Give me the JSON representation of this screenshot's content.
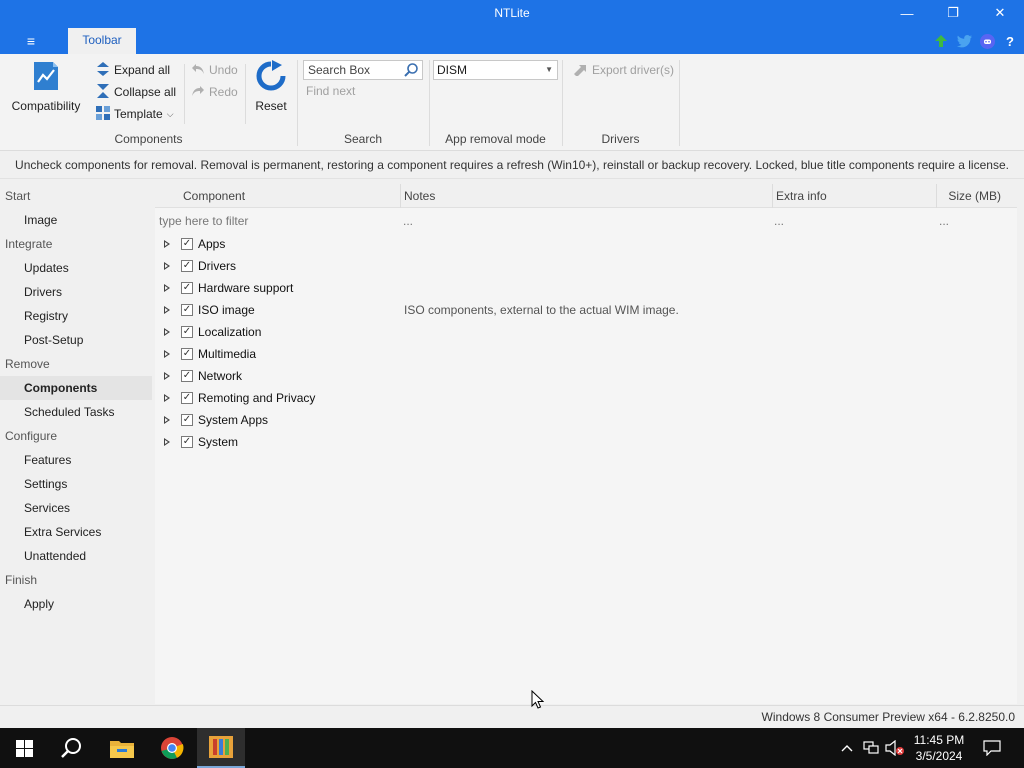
{
  "window": {
    "title": "NTLite",
    "minimize_glyph": "—",
    "maximize_glyph": "❐",
    "close_glyph": "✕"
  },
  "menu": {
    "hamburger_glyph": "≡",
    "tab_label": "Toolbar"
  },
  "top_icons": [
    "upgrade-arrow-icon",
    "twitter-icon",
    "discord-icon",
    "help-icon"
  ],
  "ribbon": {
    "compatibility_label": "Compatibility",
    "expand_all_label": "Expand all",
    "collapse_all_label": "Collapse all",
    "template_label": "Template",
    "undo_label": "Undo",
    "redo_label": "Redo",
    "reset_label": "Reset",
    "components_group": "Components",
    "search_placeholder": "Search Box",
    "find_next_label": "Find next",
    "search_group": "Search",
    "app_removal_value": "DISM",
    "app_removal_group": "App removal mode",
    "export_drivers_label": "Export driver(s)",
    "drivers_group": "Drivers"
  },
  "info_message": "Uncheck components for removal. Removal is permanent, restoring a component requires a refresh (Win10+), reinstall or backup recovery. Locked, blue title components require a license.",
  "sidebar": [
    {
      "type": "header",
      "label": "Start"
    },
    {
      "type": "item",
      "label": "Image"
    },
    {
      "type": "header",
      "label": "Integrate"
    },
    {
      "type": "item",
      "label": "Updates"
    },
    {
      "type": "item",
      "label": "Drivers"
    },
    {
      "type": "item",
      "label": "Registry"
    },
    {
      "type": "item",
      "label": "Post-Setup"
    },
    {
      "type": "header",
      "label": "Remove"
    },
    {
      "type": "item",
      "label": "Components",
      "active": true
    },
    {
      "type": "item",
      "label": "Scheduled Tasks"
    },
    {
      "type": "header",
      "label": "Configure"
    },
    {
      "type": "item",
      "label": "Features"
    },
    {
      "type": "item",
      "label": "Settings"
    },
    {
      "type": "item",
      "label": "Services"
    },
    {
      "type": "item",
      "label": "Extra Services"
    },
    {
      "type": "item",
      "label": "Unattended"
    },
    {
      "type": "header",
      "label": "Finish"
    },
    {
      "type": "item",
      "label": "Apply"
    }
  ],
  "table": {
    "columns": {
      "component": "Component",
      "notes": "Notes",
      "extra": "Extra info",
      "size": "Size (MB)"
    },
    "filter_placeholder": "type here to filter",
    "filter_ellipsis": "...",
    "rows": [
      {
        "label": "Apps",
        "checked": true,
        "note": ""
      },
      {
        "label": "Drivers",
        "checked": true,
        "note": ""
      },
      {
        "label": "Hardware support",
        "checked": true,
        "note": ""
      },
      {
        "label": "ISO image",
        "checked": true,
        "note": "ISO components, external to the actual WIM image."
      },
      {
        "label": "Localization",
        "checked": true,
        "note": ""
      },
      {
        "label": "Multimedia",
        "checked": true,
        "note": ""
      },
      {
        "label": "Network",
        "checked": true,
        "note": ""
      },
      {
        "label": "Remoting and Privacy",
        "checked": true,
        "note": ""
      },
      {
        "label": "System Apps",
        "checked": true,
        "note": ""
      },
      {
        "label": "System",
        "checked": true,
        "note": ""
      }
    ]
  },
  "status": "Windows 8 Consumer Preview x64 - 6.2.8250.0",
  "taskbar": {
    "apps": [
      "windows-start-icon",
      "search-icon",
      "file-explorer-icon",
      "chrome-icon",
      "ntlite-icon"
    ],
    "time": "11:45 PM",
    "date": "3/5/2024"
  },
  "colors": {
    "titlebar": "#1e73e6",
    "accent": "#1e5fbf"
  }
}
